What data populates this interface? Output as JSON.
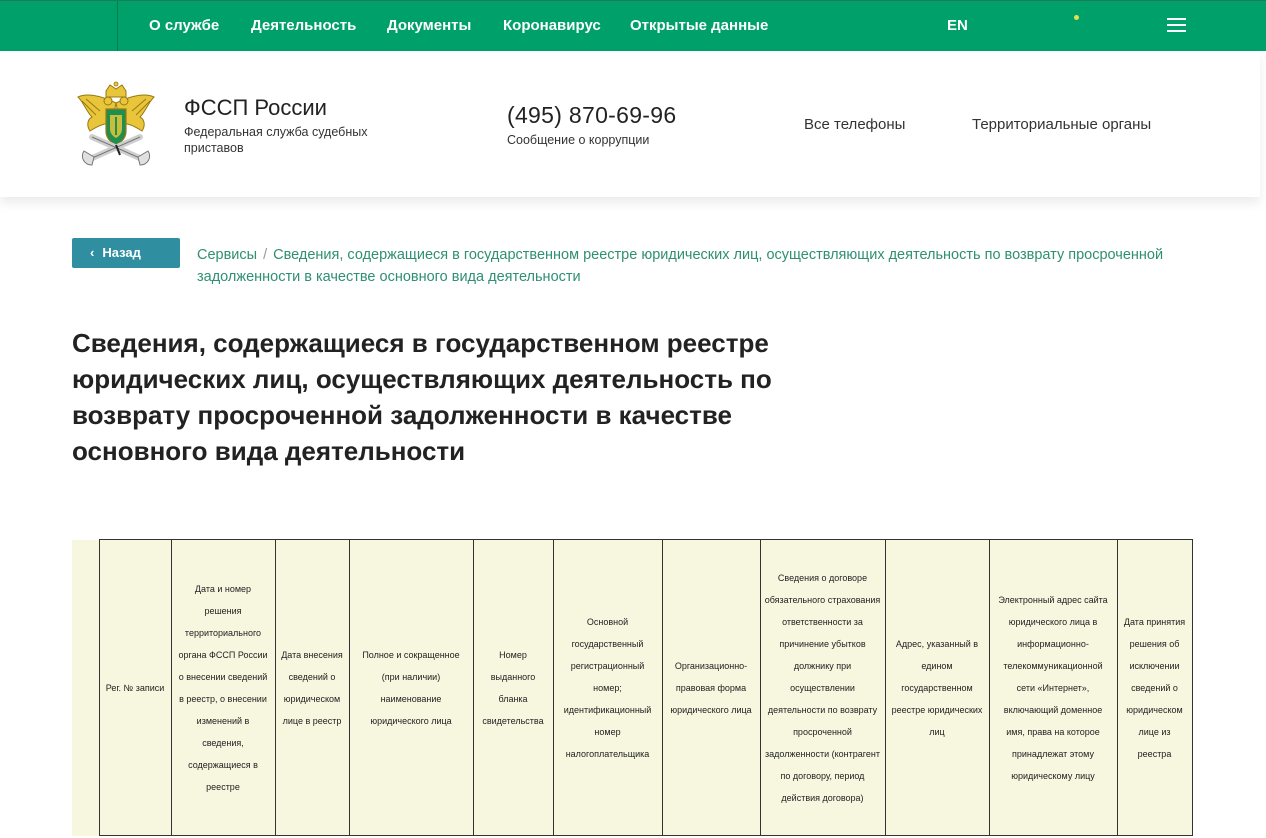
{
  "topnav": {
    "links": [
      "О службе",
      "Деятельность",
      "Документы",
      "Коронавирус",
      "Открытые данные"
    ],
    "lang": "EN"
  },
  "header": {
    "org_name": "ФССП России",
    "org_sub": "Федеральная служба судебных приставов",
    "phone": "(495) 870-69-96",
    "phone_sub": "Сообщение о коррупции",
    "all_phones": "Все телефоны",
    "territorial": "Территориальные органы"
  },
  "breadcrumb": {
    "back_label": "Назад",
    "root": "Сервисы",
    "separator": "/",
    "current": "Сведения, содержащиеся в государственном реестре юридических лиц, осуществляющих деятельность по возврату просроченной задолженности в качестве основного вида деятельности"
  },
  "page_title": "Сведения, содержащиеся в государственном реестре юридических лиц, осуществляющих деятельность по возврату просроченной задолженности в качестве основного вида деятельности",
  "table": {
    "headers": [
      "Рег. № записи",
      "Дата и номер решения территориального органа ФССП России о внесении сведений в реестр, о внесении изменений в сведения, содержащиеся в реестре",
      "Дата внесения сведений о юридическом лице в реестр",
      "Полное и сокращенное (при наличии) наименование юридического лица",
      "Номер выданного бланка свидетельства",
      "Основной государственный регистрационный номер; идентификационный номер налогоплательщика",
      "Организационно-правовая форма юридического лица",
      "Сведения о договоре обязательного страхования ответственности за причинение убытков должнику при осуществлении деятельности по возврату просроченной задолженности (контрагент по договору, период действия договора)",
      "Адрес, указанный в едином государственном реестре юридических лиц",
      "Электронный адрес сайта юридического лица в информационно-телекоммуникационной сети «Интернет», включающий доменное имя, права на которое принадлежат этому юридическому лицу",
      "Дата принятия решения об исключении сведений о юридическом лице из реестра"
    ]
  }
}
